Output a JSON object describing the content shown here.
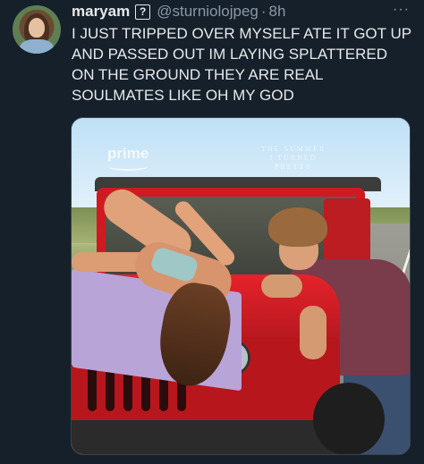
{
  "tweet": {
    "display_name": "maryam",
    "badge": "?",
    "handle": "@sturniolojpeg",
    "separator": "·",
    "time": "8h",
    "more_label": "···",
    "text": "I JUST TRIPPED OVER MYSELF ATE IT GOT UP AND PASSED OUT IM LAYING SPLATTERED ON THE GROUND THEY ARE REAL SOULMATES LIKE OH MY GOD"
  },
  "media": {
    "watermark": "prime",
    "title_overlay": "THE SUMMER\nI TURNED\nPRETTY"
  },
  "colors": {
    "background": "#15202b",
    "text": "#e7e9ea",
    "secondary": "#8b98a5",
    "jeep_red": "#cf1a22"
  }
}
